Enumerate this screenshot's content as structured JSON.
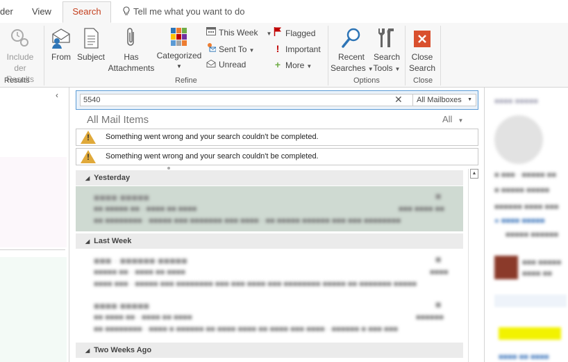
{
  "tabs": {
    "folder": "der",
    "view": "View",
    "search": "Search",
    "tell_me": "Tell me what you want to do"
  },
  "ribbon": {
    "results": {
      "include_line1": "Include",
      "include_line2": "der Results",
      "group_label": "Results"
    },
    "refine": {
      "from": "From",
      "subject": "Subject",
      "has_attachments_line1": "Has",
      "has_attachments_line2": "Attachments",
      "categorized": "Categorized",
      "this_week": "This Week",
      "sent_to": "Sent To",
      "unread": "Unread",
      "flagged": "Flagged",
      "important": "Important",
      "more": "More",
      "group_label": "Refine"
    },
    "options": {
      "recent_line1": "Recent",
      "recent_line2": "Searches",
      "tools_line1": "Search",
      "tools_line2": "Tools",
      "group_label": "Options"
    },
    "close": {
      "close_line1": "Close",
      "close_line2": "Search",
      "group_label": "Close"
    }
  },
  "search": {
    "query": "5540",
    "scope": "All Mailboxes"
  },
  "list": {
    "heading": "All Mail Items",
    "filter": "All",
    "errors": [
      "Something went wrong and your search couldn't be completed.",
      "Something went wrong and your search couldn't be completed."
    ],
    "groups": {
      "yesterday": "Yesterday",
      "last_week": "Last Week",
      "two_weeks_ago": "Two Weeks Ago"
    }
  },
  "colors": {
    "accent": "#c43e1c",
    "selection": "#cfdad2",
    "search_border": "#5b9bd5"
  }
}
